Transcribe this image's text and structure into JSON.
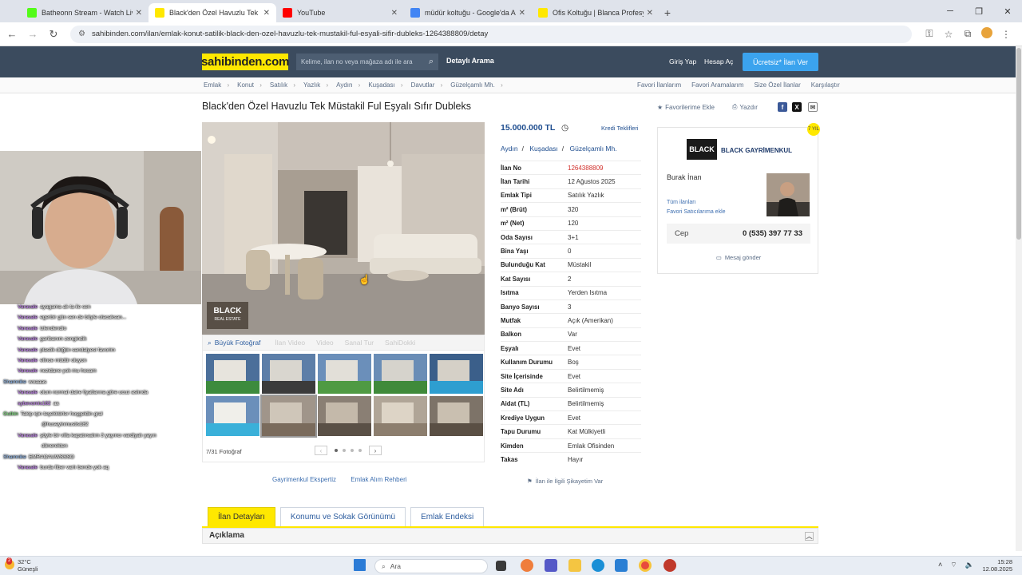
{
  "browser": {
    "tabs": [
      {
        "label": "Batheonn Stream - Watch Live",
        "favicon_color": "#53fc18",
        "active": false
      },
      {
        "label": "Black'den Özel Havuzlu Tek Mü",
        "favicon_color": "#ffe800",
        "active": true
      },
      {
        "label": "YouTube",
        "favicon_color": "#ff0000",
        "active": false
      },
      {
        "label": "müdür koltuğu - Google'da Ara",
        "favicon_color": "#4285f4",
        "active": false
      },
      {
        "label": "Ofis Koltuğu | Blanca Profesyon",
        "favicon_color": "#ffe800",
        "active": false
      }
    ],
    "url": "sahibinden.com/ilan/emlak-konut-satilik-black-den-ozel-havuzlu-tek-mustakil-ful-esyali-sifir-dubleks-1264388809/detay"
  },
  "header": {
    "logo": "sahibinden.com",
    "search_placeholder": "Kelime, ilan no veya mağaza adı ile ara",
    "detayli": "Detaylı Arama",
    "giris": "Giriş Yap",
    "hesap": "Hesap Aç",
    "ilan_ver": "Ücretsiz* İlan Ver"
  },
  "breadcrumbs": [
    "Emlak",
    "Konut",
    "Satılık",
    "Yazlık",
    "Aydın",
    "Kuşadası",
    "Davutlar",
    "Güzelçamlı Mh."
  ],
  "breadcrumb_right": [
    "Favori İlanlarım",
    "Favori Aramalarım",
    "Size Özel İlanlar",
    "Karşılaştır"
  ],
  "listing": {
    "title": "Black'den Özel Havuzlu Tek Müstakil Ful Eşyalı Sıfır Dubleks",
    "favori": "Favorilerime Ekle",
    "yazdir": "Yazdır",
    "price": "15.000.000 TL",
    "kredi": "Kredi Teklifleri",
    "location": [
      "Aydın",
      "Kuşadası",
      "Güzelçamlı Mh."
    ],
    "watermark": "BLACK",
    "watermark_sub": "REAL ESTATE",
    "buyuk_foto": "Büyük Fotoğraf",
    "media_disabled": [
      "İlan Video",
      "Video",
      "Sanal Tur",
      "SahiDokki"
    ],
    "foto_count": "7/31 Fotoğraf",
    "details": [
      {
        "k": "İlan No",
        "v": "1264388809",
        "red": true
      },
      {
        "k": "İlan Tarihi",
        "v": "12 Ağustos 2025"
      },
      {
        "k": "Emlak Tipi",
        "v": "Satılık Yazlık"
      },
      {
        "k": "m² (Brüt)",
        "v": "320"
      },
      {
        "k": "m² (Net)",
        "v": "120"
      },
      {
        "k": "Oda Sayısı",
        "v": "3+1"
      },
      {
        "k": "Bina Yaşı",
        "v": "0"
      },
      {
        "k": "Bulunduğu Kat",
        "v": "Müstakil"
      },
      {
        "k": "Kat Sayısı",
        "v": "2"
      },
      {
        "k": "Isıtma",
        "v": "Yerden Isıtma"
      },
      {
        "k": "Banyo Sayısı",
        "v": "3"
      },
      {
        "k": "Mutfak",
        "v": "Açık (Amerikan)"
      },
      {
        "k": "Balkon",
        "v": "Var"
      },
      {
        "k": "Eşyalı",
        "v": "Evet"
      },
      {
        "k": "Kullanım Durumu",
        "v": "Boş"
      },
      {
        "k": "Site İçerisinde",
        "v": "Evet"
      },
      {
        "k": "Site Adı",
        "v": "Belirtilmemiş"
      },
      {
        "k": "Aidat (TL)",
        "v": "Belirtilmemiş"
      },
      {
        "k": "Krediye Uygun",
        "v": "Evet"
      },
      {
        "k": "Tapu Durumu",
        "v": "Kat Mülkiyetli"
      },
      {
        "k": "Kimden",
        "v": "Emlak Ofisinden"
      },
      {
        "k": "Takas",
        "v": "Hayır"
      }
    ],
    "sikayet": "İlan ile İlgili Şikayetim Var"
  },
  "seller": {
    "badge": "7 YIL",
    "logo_text": "BLACK",
    "company": "BLACK GAYRİMENKUL",
    "name": "Burak İnan",
    "tum_ilanlari": "Tüm ilanları",
    "favori_satici": "Favori Satıcılarıma ekle",
    "cep_label": "Cep",
    "cep_number": "0 (535) 397 77 33",
    "mesaj": "Mesaj gönder"
  },
  "under_links": [
    "Gayrimenkul Ekspertiz",
    "Emlak Alım Rehberi"
  ],
  "detail_tabs": [
    "İlan Detayları",
    "Konumu ve Sokak Görünümü",
    "Emlak Endeksi"
  ],
  "aciklama": "Açıklama",
  "chat": [
    {
      "u": "Varasale",
      "m": "ayagama ak ta ile sen",
      "c": ""
    },
    {
      "u": "Varasale",
      "m": "egerbir gün sen de böyle olacaksan...",
      "c": ""
    },
    {
      "u": "Varasale",
      "m": "izlendendio",
      "c": ""
    },
    {
      "u": "Varasale",
      "m": "garibanım zengindik",
      "c": ""
    },
    {
      "u": "Varasale",
      "m": "plastik düğün sandalyesi favorim",
      "c": ""
    },
    {
      "u": "Varasale",
      "m": "elince müdür oluyon",
      "c": ""
    },
    {
      "u": "Varasale",
      "m": "nezidane yok mu hocam",
      "c": ""
    },
    {
      "u": "Shamnike",
      "m": "woaaas",
      "c": "b"
    },
    {
      "u": "Varasale",
      "m": "olum normal daire fiyatlarına göre ucuz aslında",
      "c": ""
    },
    {
      "u": "sybevomis182",
      "m": "aa",
      "c": ""
    },
    {
      "u": "Gutkin",
      "m": "Takip için teşekkürler hoşgeldin gral",
      "c": "g"
    },
    {
      "u": "",
      "m": "@huseyinmustis182",
      "c": ""
    },
    {
      "u": "Varasale",
      "m": "şöyle bir villa kapatırsalım 3 yayıncı vardiyalı yayın",
      "c": ""
    },
    {
      "u": "",
      "m": "dönerekten",
      "c": ""
    },
    {
      "u": "Shamnike",
      "m": "EMRAOAUWSSSO",
      "c": "b"
    },
    {
      "u": "Varasale",
      "m": "burda fiber varlı bende yok aq",
      "c": ""
    }
  ],
  "taskbar": {
    "temp": "32°C",
    "weather": "Güneşli",
    "search": "Ara",
    "time": "15:28",
    "date": "12.08.2025",
    "notif": "2"
  }
}
